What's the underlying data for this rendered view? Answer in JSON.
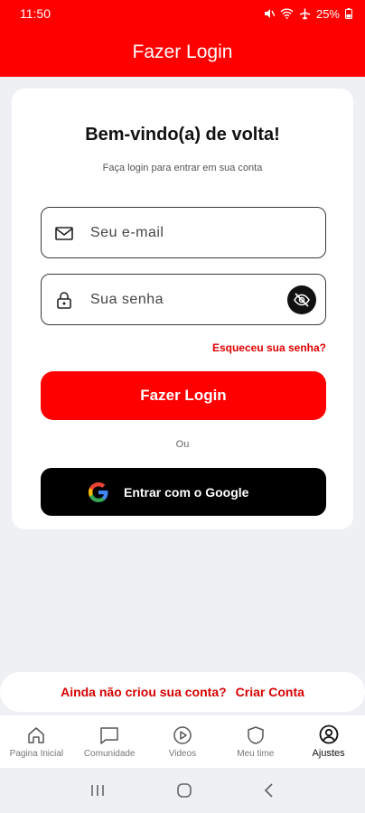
{
  "status": {
    "time": "11:50",
    "battery": "25%"
  },
  "header": {
    "title": "Fazer Login"
  },
  "card": {
    "welcome": "Bem-vindo(a) de volta!",
    "subtitle": "Faça login para entrar em sua conta",
    "email_placeholder": "Seu e-mail",
    "email_value": "",
    "password_placeholder": "Sua senha",
    "password_value": "",
    "forgot_label": "Esqueceu sua senha?",
    "login_label": "Fazer Login",
    "or_label": "Ou",
    "google_label": "Entrar com o Google"
  },
  "signup": {
    "question": "Ainda não criou sua conta?",
    "link": "Criar Conta"
  },
  "nav": {
    "items": [
      {
        "label": "Pagina Inicial",
        "icon": "home-icon"
      },
      {
        "label": "Comunidade",
        "icon": "chat-icon"
      },
      {
        "label": "Videos",
        "icon": "play-icon"
      },
      {
        "label": "Meu time",
        "icon": "shield-icon"
      },
      {
        "label": "Ajustes",
        "icon": "user-circle-icon",
        "active": true
      }
    ]
  },
  "colors": {
    "brand": "#ff0000",
    "link": "#e00000",
    "google_button": "#000000"
  }
}
